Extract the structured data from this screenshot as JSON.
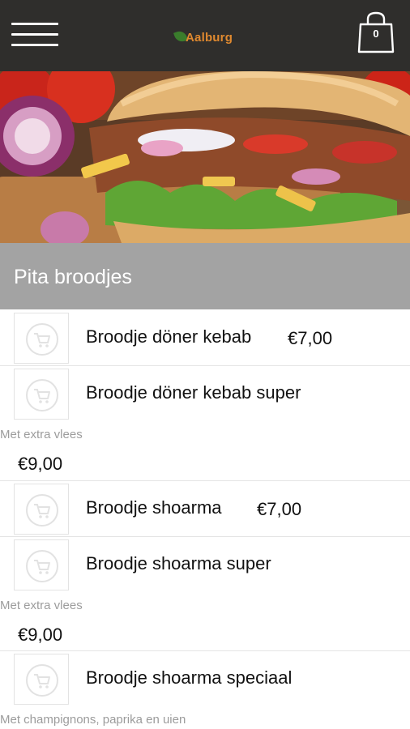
{
  "header": {
    "logo_text": "Aalburg",
    "cart_count": "0",
    "colors": {
      "bar": "#2f2e2c",
      "logo_text": "#e0892f",
      "logo_leaf": "#3a7d2c"
    }
  },
  "hero": {
    "image_alt_icon": "pita-sandwich-photo"
  },
  "section": {
    "title": "Pita broodjes"
  },
  "items": [
    {
      "name": "Broodje döner kebab",
      "price": "€7,00"
    },
    {
      "name": "Broodje döner kebab super",
      "description": "Met extra vlees",
      "price": "€9,00"
    },
    {
      "name": "Broodje shoarma",
      "price": "€7,00"
    },
    {
      "name": "Broodje shoarma super",
      "description": "Met extra vlees",
      "price": "€9,00"
    },
    {
      "name": "Broodje shoarma speciaal",
      "description": "Met champignons, paprika en uien"
    }
  ]
}
